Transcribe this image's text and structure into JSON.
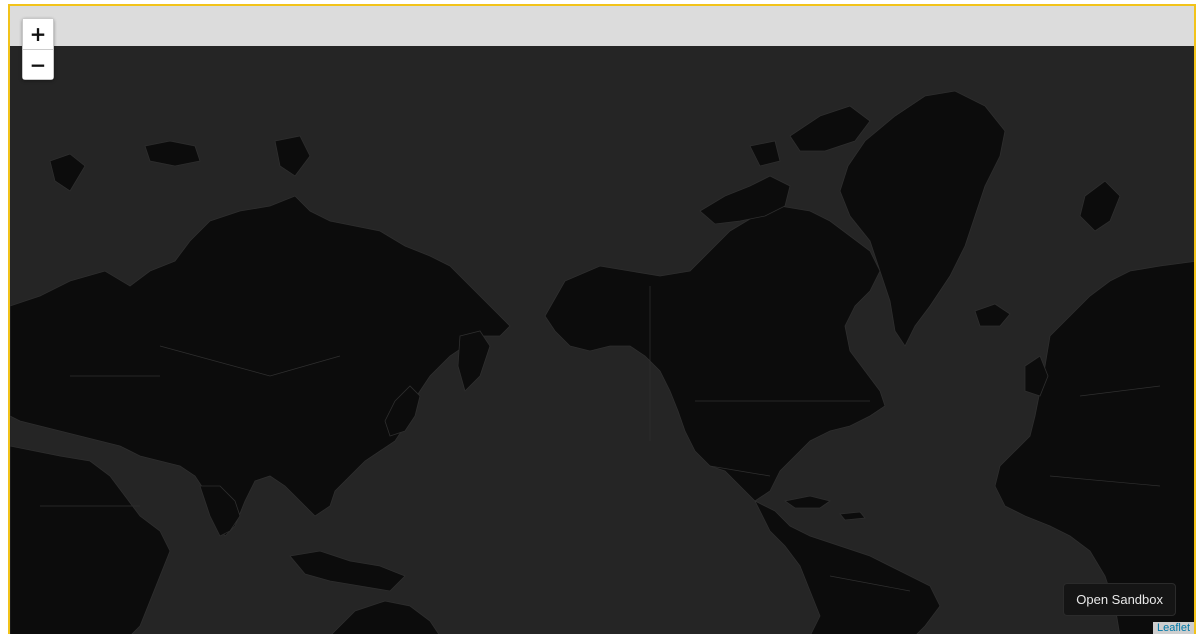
{
  "map": {
    "type": "world",
    "theme": "dark",
    "background_color": "#252525",
    "land_color": "#0c0c0c",
    "frame_color": "#f2c31a"
  },
  "zoom_control": {
    "zoom_in_label": "+",
    "zoom_out_label": "−"
  },
  "sandbox_button": {
    "label": "Open Sandbox"
  },
  "attribution": {
    "label": "Leaflet"
  }
}
